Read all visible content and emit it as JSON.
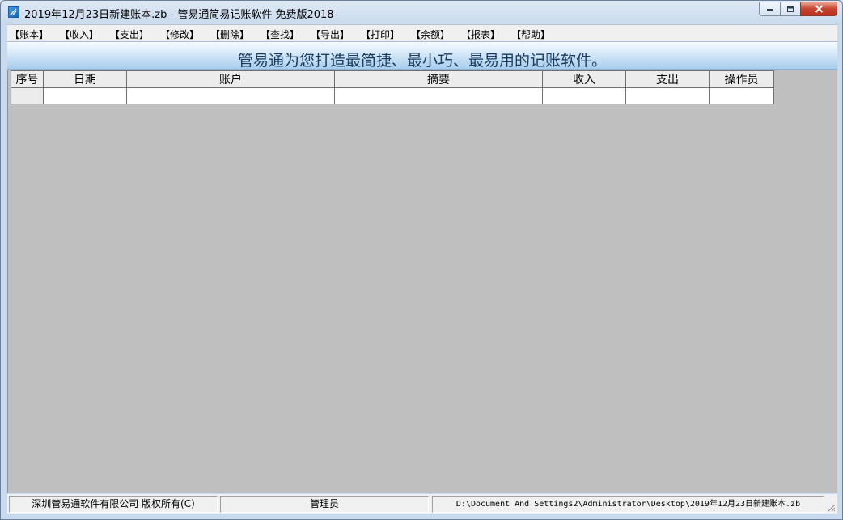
{
  "window": {
    "title": "2019年12月23日新建账本.zb - 管易通简易记账软件 免费版2018",
    "icon": "app-icon"
  },
  "menu": [
    {
      "label": "【账本】"
    },
    {
      "label": "【收入】"
    },
    {
      "label": "【支出】"
    },
    {
      "label": "【修改】"
    },
    {
      "label": "【删除】"
    },
    {
      "label": "【查找】"
    },
    {
      "label": "【导出】"
    },
    {
      "label": "【打印】"
    },
    {
      "label": "【余额】"
    },
    {
      "label": "【报表】"
    },
    {
      "label": "【帮助】"
    }
  ],
  "banner": {
    "text": "管易通为您打造最简捷、最小巧、最易用的记账软件。"
  },
  "table": {
    "columns": [
      "序号",
      "日期",
      "账户",
      "摘要",
      "收入",
      "支出",
      "操作员"
    ],
    "rows": [
      [
        "",
        "",
        "",
        "",
        "",
        "",
        ""
      ]
    ]
  },
  "status": {
    "copyright": "深圳管易通软件有限公司 版权所有(C)",
    "user": "管理员",
    "path": "D:\\Document And Settings2\\Administrator\\Desktop\\2019年12月23日新建账本.zb"
  },
  "colors": {
    "banner_text": "#183b5d",
    "grid_background": "#bfbfbf",
    "close_button": "#c7432f"
  }
}
